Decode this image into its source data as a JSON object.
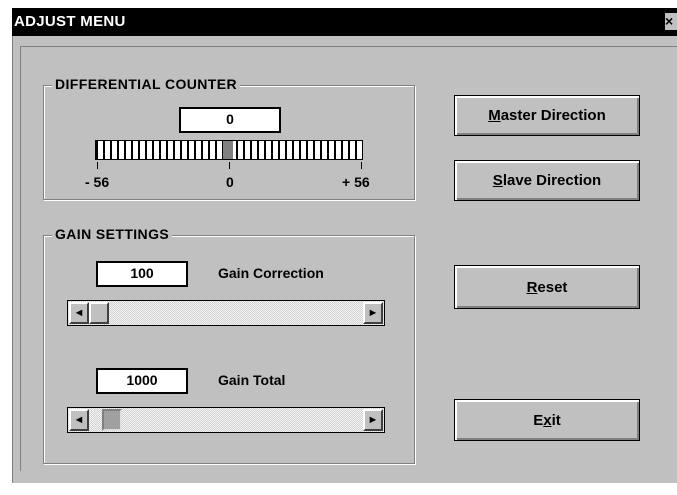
{
  "window": {
    "title": "ADJUST MENU",
    "close_glyph": "×"
  },
  "differential": {
    "group_label": "DIFFERENTIAL COUNTER",
    "counter_value": "0",
    "scale_min": "- 56",
    "scale_mid": "0",
    "scale_max": "+ 56"
  },
  "gain": {
    "group_label": "GAIN SETTINGS",
    "correction_value": "100",
    "correction_label": "Gain Correction",
    "total_value": "1000",
    "total_label": "Gain Total",
    "left_arrow": "◄",
    "right_arrow": "►"
  },
  "buttons": {
    "master": {
      "mnemonic": "M",
      "rest": "aster Direction"
    },
    "slave": {
      "mnemonic": "S",
      "rest": "lave Direction"
    },
    "reset": {
      "mnemonic": "R",
      "rest": "eset"
    },
    "exit": {
      "pre": "E",
      "mnemonic": "x",
      "rest": "it"
    }
  }
}
